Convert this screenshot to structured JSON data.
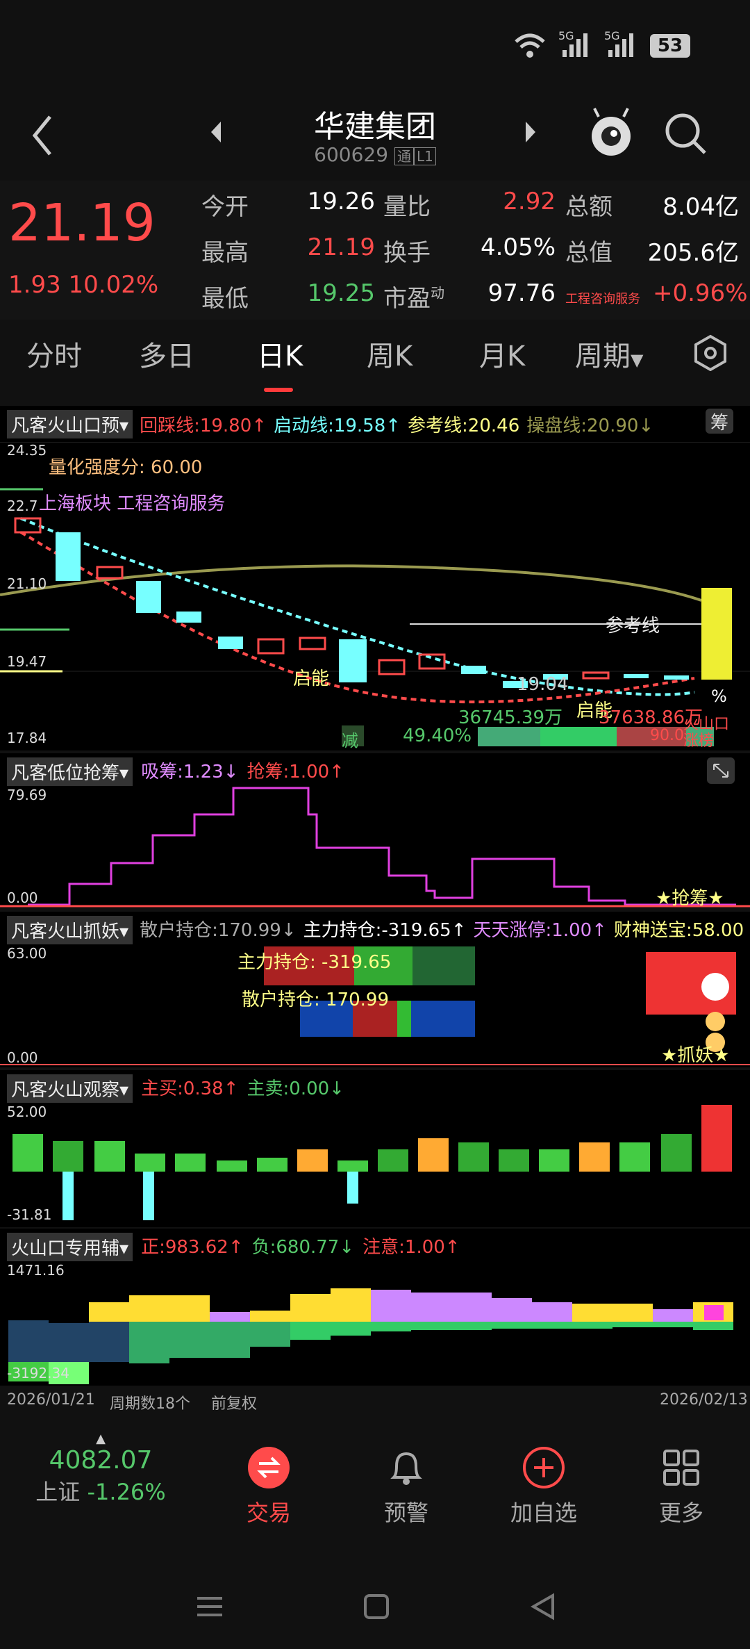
{
  "status_bar": {
    "battery": "53",
    "sig1": "5G",
    "sig2": "5G"
  },
  "header": {
    "back_icon": "back-icon",
    "name": "华建集团",
    "code": "600629",
    "badge1": "通",
    "badge2": "L1"
  },
  "quote": {
    "price": "21.19",
    "change": "1.93",
    "pct": "10.02%",
    "open_l": "今开",
    "open_v": "19.26",
    "qr_l": "量比",
    "qr_v": "2.92",
    "amt_l": "总额",
    "amt_v": "8.04亿",
    "high_l": "最高",
    "high_v": "21.19",
    "tr_l": "换手",
    "tr_v": "4.05%",
    "mv_l": "总值",
    "mv_v": "205.6亿",
    "low_l": "最低",
    "low_v": "19.25",
    "pe_l": "市盈",
    "pe_sup": "动",
    "pe_v": "97.76",
    "ind_l": "工程咨询服务",
    "ind_v": "+0.96%"
  },
  "tabs": [
    "分时",
    "多日",
    "日K",
    "周K",
    "月K",
    "周期"
  ],
  "chart1": {
    "name": "凡客火山口预",
    "l1": "回踩线:19.80↑",
    "l2": "启动线:19.58↑",
    "l3": "参考线:20.46",
    "l4": "操盘线:20.90↓",
    "corner": "筹",
    "y1": "24.35",
    "y2": "22.7",
    "y3": "21.10",
    "y4": "19.47",
    "y5": "17.84",
    "t1": "量化强度分:  60.00",
    "t2": "上海板块 工程咨询服务",
    "t3": "参考线",
    "t4": "启能",
    "t5": "启能",
    "t6": "19.04",
    "t7": "36745.39万",
    "t8": "37638.86万",
    "t9": "49.40%",
    "t10": "减",
    "t11": "%",
    "t12": "火山口",
    "t13": "涨榜",
    "t14": "90.0"
  },
  "chart2": {
    "name": "凡客低位抢筹",
    "l1": "吸筹:1.23↓",
    "l2": "抢筹:1.00↑",
    "y1": "79.69",
    "y2": "0.00",
    "t1": "★抢筹★"
  },
  "chart3": {
    "name": "凡客火山抓妖",
    "l1": "散户持仓:170.99↓",
    "l2": "主力持仓:-319.65↑",
    "l3": "天天涨停:1.00↑",
    "l4": "财神送宝:58.00",
    "y1": "63.00",
    "y2": "0.00",
    "t1": "主力持仓: -319.65",
    "t2": "散户持仓: 170.99",
    "t3": "★抓妖★"
  },
  "chart4": {
    "name": "凡客火山观察",
    "l1": "主买:0.38↑",
    "l2": "主卖:0.00↓",
    "y1": "52.00",
    "y2": "-31.81"
  },
  "chart5": {
    "name": "火山口专用辅",
    "l1": "正:983.62↑",
    "l2": "负:680.77↓",
    "l3": "注意:1.00↑",
    "y1": "1471.16",
    "y2": "-3192.34"
  },
  "footer_axis": {
    "d1": "2026/01/21",
    "count": "周期数18个",
    "adj": "前复权",
    "d2": "2026/02/13"
  },
  "bottom": {
    "index_v": "4082.07",
    "index_n": "上证",
    "index_p": "-1.26%",
    "trade": "交易",
    "alert": "预警",
    "add": "加自选",
    "more": "更多"
  },
  "colors": {
    "up": "#ff4b4b",
    "down": "#56c86b",
    "cyan": "#7ff",
    "bg": "#000"
  }
}
